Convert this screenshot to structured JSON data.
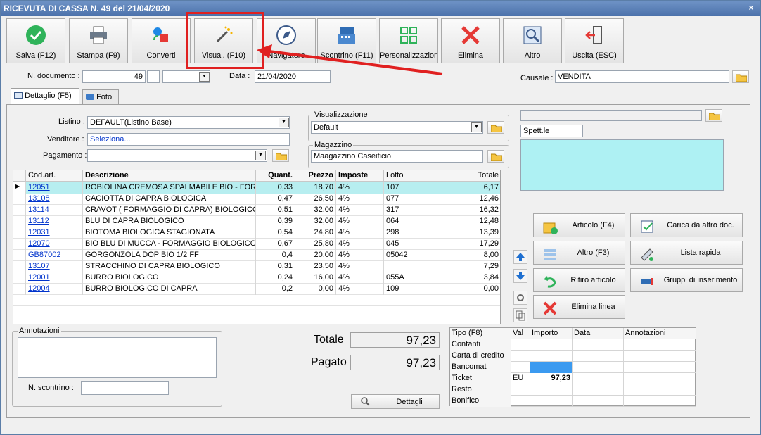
{
  "window": {
    "title": "RICEVUTA DI CASSA N. 49 del 21/04/2020",
    "close": "×"
  },
  "toolbar": [
    {
      "label": "Salva (F12)",
      "icon": "check-icon"
    },
    {
      "label": "Stampa (F9)",
      "icon": "printer-icon"
    },
    {
      "label": "Converti",
      "icon": "convert-icon"
    },
    {
      "label": "Visual. (F10)",
      "icon": "magic-wand-icon"
    },
    {
      "label": "Navigatore",
      "icon": "compass-icon"
    },
    {
      "label": "Scontrino (F11)",
      "icon": "cash-register-icon"
    },
    {
      "label": "Personalizzazioni",
      "icon": "grid-icon"
    },
    {
      "label": "Elimina",
      "icon": "delete-x-icon"
    },
    {
      "label": "Altro",
      "icon": "magnifier-icon"
    },
    {
      "label": "Uscita (ESC)",
      "icon": "exit-icon"
    }
  ],
  "header": {
    "doc_label": "N. documento :",
    "doc_value": "49",
    "date_label": "Data :",
    "date_value": "21/04/2020",
    "causale_label": "Causale :",
    "causale_value": "VENDITA"
  },
  "tabs": [
    {
      "label": "Dettaglio (F5)",
      "icon": "table-icon"
    },
    {
      "label": "Foto",
      "icon": "camera-icon"
    }
  ],
  "form": {
    "listino_label": "Listino :",
    "listino_value": "DEFAULT(Listino Base)",
    "venditore_label": "Venditore :",
    "venditore_value": "Seleziona...",
    "pagamento_label": "Pagamento :",
    "pagamento_value": "",
    "visualizzazione_label": "Visualizzazione",
    "visualizzazione_value": "Default",
    "magazzino_label": "Magazzino",
    "magazzino_value": "Maagazzino Caseificio",
    "customer_value": "",
    "spett_value": "Spett.le",
    "notes_value": ""
  },
  "grid": {
    "columns": [
      "Cod.art.",
      "Descrizione",
      "Quant.",
      "Prezzo",
      "Imposte",
      "Lotto",
      "Totale"
    ],
    "rows": [
      {
        "cod": "12051",
        "desc": "ROBIOLINA CREMOSA SPALMABILE BIO - FOR...",
        "qty": "0,33",
        "price": "18,70",
        "tax": "4%",
        "lotto": "107",
        "tot": "6,17"
      },
      {
        "cod": "13108",
        "desc": "CACIOTTA DI CAPRA BIOLOGICA",
        "qty": "0,47",
        "price": "26,50",
        "tax": "4%",
        "lotto": "077",
        "tot": "12,46"
      },
      {
        "cod": "13114",
        "desc": "CRAVOT ( FORMAGGIO DI CAPRA) BIOLOGICO",
        "qty": "0,51",
        "price": "32,00",
        "tax": "4%",
        "lotto": "317",
        "tot": "16,32"
      },
      {
        "cod": "13112",
        "desc": "BLU DI CAPRA BIOLOGICO",
        "qty": "0,39",
        "price": "32,00",
        "tax": "4%",
        "lotto": "064",
        "tot": "12,48"
      },
      {
        "cod": "12031",
        "desc": "BIOTOMA BIOLOGICA STAGIONATA",
        "qty": "0,54",
        "price": "24,80",
        "tax": "4%",
        "lotto": "298",
        "tot": "13,39"
      },
      {
        "cod": "12070",
        "desc": "BIO BLU DI MUCCA - FORMAGGIO BIOLOGICO",
        "qty": "0,67",
        "price": "25,80",
        "tax": "4%",
        "lotto": "045",
        "tot": "17,29"
      },
      {
        "cod": "GB87002",
        "desc": "GORGONZOLA DOP BIO 1/2 FF",
        "qty": "0,4",
        "price": "20,00",
        "tax": "4%",
        "lotto": "05042",
        "tot": "8,00"
      },
      {
        "cod": "13107",
        "desc": "STRACCHINO DI CAPRA BIOLOGICO",
        "qty": "0,31",
        "price": "23,50",
        "tax": "4%",
        "lotto": "",
        "tot": "7,29"
      },
      {
        "cod": "12001",
        "desc": "BURRO BIOLOGICO",
        "qty": "0,24",
        "price": "16,00",
        "tax": "4%",
        "lotto": "055A",
        "tot": "3,84"
      },
      {
        "cod": "12004",
        "desc": "BURRO BIOLOGICO DI CAPRA",
        "qty": "0,2",
        "price": "0,00",
        "tax": "4%",
        "lotto": "109",
        "tot": "0,00"
      }
    ]
  },
  "actions": {
    "articolo": "Articolo (F4)",
    "carica": "Carica da altro doc.",
    "altro": "Altro (F3)",
    "lista": "Lista rapida",
    "ritiro": "Ritiro articolo",
    "gruppi": "Gruppi di inserimento",
    "elimina": "Elimina linea"
  },
  "notes": {
    "annotazioni_label": "Annotazioni",
    "scontrino_label": "N. scontrino :",
    "scontrino_value": ""
  },
  "totals": {
    "totale_label": "Totale",
    "totale_value": "97,23",
    "pagato_label": "Pagato",
    "pagato_value": "97,23",
    "dettagli_label": "Dettagli"
  },
  "payments": {
    "columns": [
      "Tipo (F8)",
      "Val",
      "Importo",
      "Data",
      "Annotazioni"
    ],
    "rows": [
      {
        "tipo": "Contanti",
        "val": "",
        "importo": ""
      },
      {
        "tipo": "Carta di credito",
        "val": "",
        "importo": ""
      },
      {
        "tipo": "Bancomat",
        "val": "",
        "importo": ""
      },
      {
        "tipo": "Ticket",
        "val": "EU",
        "importo": "97,23"
      },
      {
        "tipo": "Resto",
        "val": "",
        "importo": ""
      },
      {
        "tipo": "Bonifico",
        "val": "",
        "importo": ""
      }
    ]
  },
  "colors": {
    "accent": "#e02020",
    "selection": "#b7eef0",
    "title": "#4c72ab"
  }
}
